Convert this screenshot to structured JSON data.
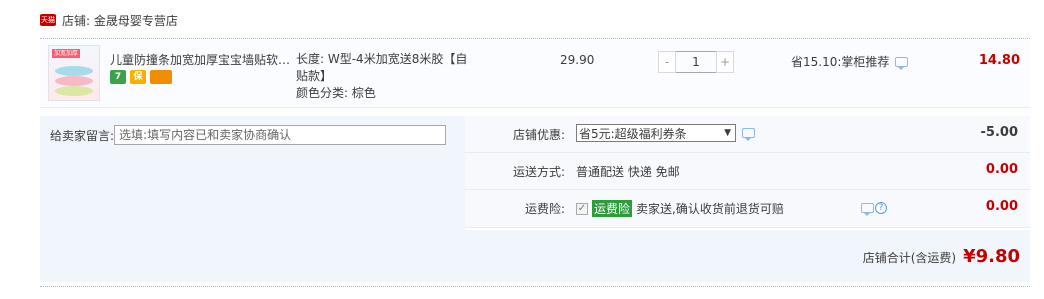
{
  "shop": {
    "badge": "天猫",
    "name": "店铺: 金晟母婴专营店"
  },
  "item": {
    "title": "儿童防撞条加宽加厚宝宝墙贴软…",
    "thumb_label": "加宽加厚",
    "badges": [
      {
        "name": "7-day-return-badge",
        "text": "7"
      },
      {
        "name": "guarantee-badge",
        "text": "保"
      },
      {
        "name": "card-badge",
        "text": ""
      }
    ],
    "spec_line1": "长度: W型-4米加宽送8米胶【自贴款】",
    "spec_line2": "颜色分类: 棕色",
    "price": "29.90",
    "quantity": "1",
    "minus": "-",
    "plus": "+",
    "promo": "省15.10:掌柜推荐",
    "subtotal": "14.80"
  },
  "message": {
    "label": "给卖家留言:",
    "placeholder": "选填:填写内容已和卖家协商确认"
  },
  "options": {
    "discount": {
      "label": "店铺优惠:",
      "value": "省5元:超级福利券条",
      "amount": "-5.00"
    },
    "shipping": {
      "label": "运送方式:",
      "value": "普通配送 快递 免邮",
      "amount": "0.00"
    },
    "freight_insurance": {
      "label": "运费险:",
      "tag": "运费险",
      "value": "卖家送,确认收货前退货可赔",
      "amount": "0.00"
    }
  },
  "total": {
    "label": "店铺合计(含运费)",
    "value": "¥9.80"
  },
  "colors": {
    "accent_red": "#c40000",
    "freight_green": "#2d9c3a",
    "panel_blue": "#f1f6fd"
  }
}
